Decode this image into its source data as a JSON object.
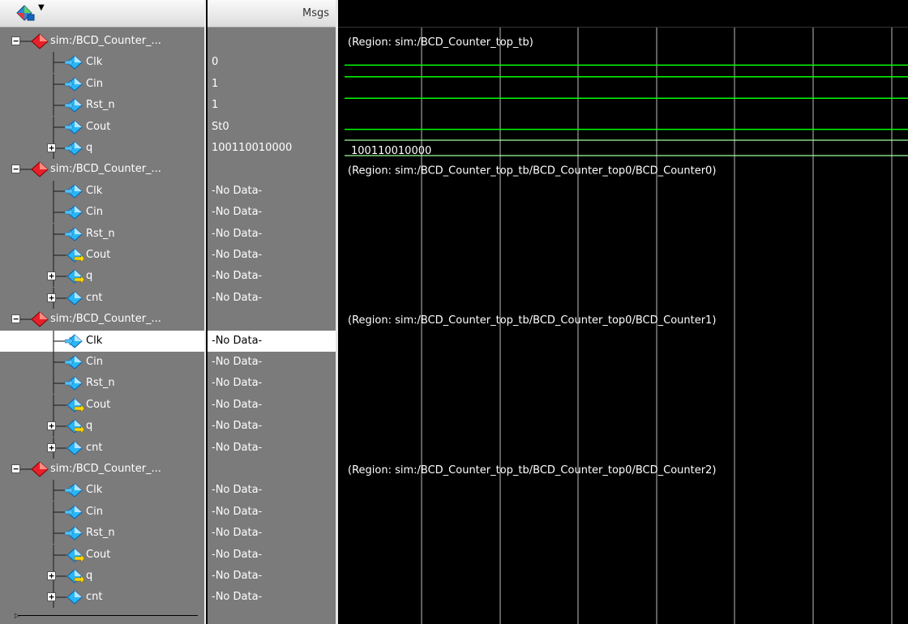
{
  "header": {
    "values_title": "Msgs"
  },
  "rows": [
    {
      "kind": "region",
      "label": "sim:/BCD_Counter_...",
      "value": "",
      "expand": "minus",
      "region": "(Region: sim:/BCD_Counter_top_tb)"
    },
    {
      "kind": "signal",
      "label": "Clk",
      "value": "0",
      "icon": "input",
      "wave": "low"
    },
    {
      "kind": "signal",
      "label": "Cin",
      "value": "1",
      "icon": "input",
      "wave": "high"
    },
    {
      "kind": "signal",
      "label": "Rst_n",
      "value": "1",
      "icon": "input",
      "wave": "high"
    },
    {
      "kind": "signal",
      "label": "Cout",
      "value": "St0",
      "icon": "input",
      "wave": "low"
    },
    {
      "kind": "signal",
      "label": "q",
      "value": "100110010000",
      "icon": "input",
      "expand": "plus",
      "wave": "bus",
      "bus_text": "100110010000"
    },
    {
      "kind": "region",
      "label": "sim:/BCD_Counter_...",
      "value": "",
      "expand": "minus",
      "region": "(Region: sim:/BCD_Counter_top_tb/BCD_Counter_top0/BCD_Counter0)"
    },
    {
      "kind": "signal",
      "label": "Clk",
      "value": "-No Data-",
      "icon": "input"
    },
    {
      "kind": "signal",
      "label": "Cin",
      "value": "-No Data-",
      "icon": "input"
    },
    {
      "kind": "signal",
      "label": "Rst_n",
      "value": "-No Data-",
      "icon": "input"
    },
    {
      "kind": "signal",
      "label": "Cout",
      "value": "-No Data-",
      "icon": "output"
    },
    {
      "kind": "signal",
      "label": "q",
      "value": "-No Data-",
      "icon": "output",
      "expand": "plus"
    },
    {
      "kind": "signal",
      "label": "cnt",
      "value": "-No Data-",
      "icon": "internal",
      "expand": "plus"
    },
    {
      "kind": "region",
      "label": "sim:/BCD_Counter_...",
      "value": "",
      "expand": "minus",
      "region": "(Region: sim:/BCD_Counter_top_tb/BCD_Counter_top0/BCD_Counter1)"
    },
    {
      "kind": "signal",
      "label": "Clk",
      "value": "-No Data-",
      "icon": "input",
      "selected": true
    },
    {
      "kind": "signal",
      "label": "Cin",
      "value": "-No Data-",
      "icon": "input"
    },
    {
      "kind": "signal",
      "label": "Rst_n",
      "value": "-No Data-",
      "icon": "input"
    },
    {
      "kind": "signal",
      "label": "Cout",
      "value": "-No Data-",
      "icon": "output"
    },
    {
      "kind": "signal",
      "label": "q",
      "value": "-No Data-",
      "icon": "output",
      "expand": "plus"
    },
    {
      "kind": "signal",
      "label": "cnt",
      "value": "-No Data-",
      "icon": "internal",
      "expand": "plus"
    },
    {
      "kind": "region",
      "label": "sim:/BCD_Counter_...",
      "value": "",
      "expand": "minus",
      "region": "(Region: sim:/BCD_Counter_top_tb/BCD_Counter_top0/BCD_Counter2)"
    },
    {
      "kind": "signal",
      "label": "Clk",
      "value": "-No Data-",
      "icon": "input"
    },
    {
      "kind": "signal",
      "label": "Cin",
      "value": "-No Data-",
      "icon": "input"
    },
    {
      "kind": "signal",
      "label": "Rst_n",
      "value": "-No Data-",
      "icon": "input"
    },
    {
      "kind": "signal",
      "label": "Cout",
      "value": "-No Data-",
      "icon": "output"
    },
    {
      "kind": "signal",
      "label": "q",
      "value": "-No Data-",
      "icon": "output",
      "expand": "plus"
    },
    {
      "kind": "signal",
      "label": "cnt",
      "value": "-No Data-",
      "icon": "internal",
      "expand": "plus"
    }
  ],
  "colors": {
    "wave": "#00ff00",
    "bus": "#a0ffa0",
    "region_diamond": "#e8202a",
    "signal_diamond": "#29b6f6",
    "output_arrow": "#ffd600",
    "grid": "#bdbdbd",
    "pane_bg": "#7b7b7b",
    "selected_bg": "#ffffff"
  }
}
